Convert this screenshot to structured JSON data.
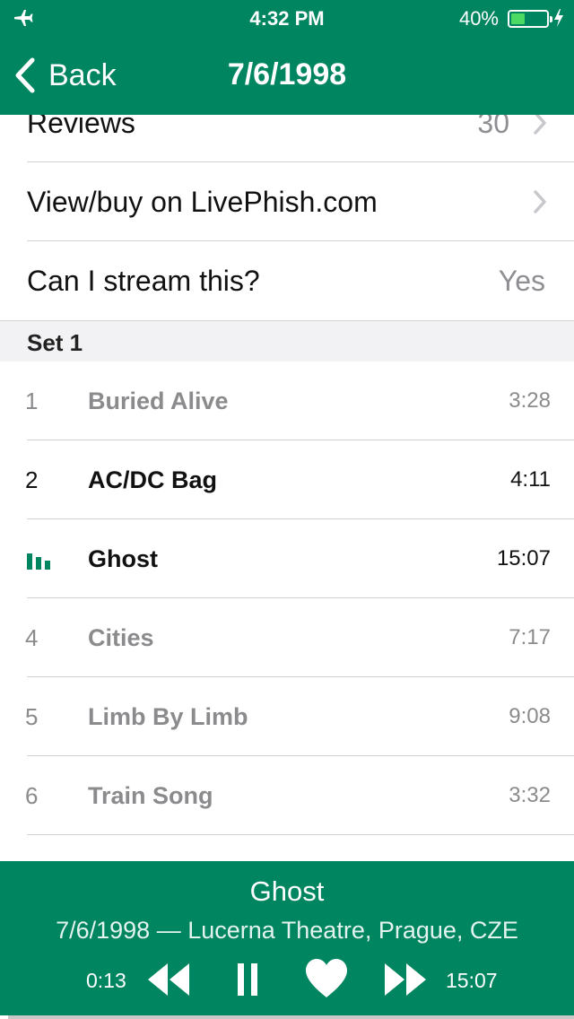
{
  "status_bar": {
    "time": "4:32 PM",
    "battery_percent": "40%",
    "battery_level": 0.4,
    "icons": [
      "airplane-icon",
      "battery-icon",
      "charging-bolt-icon"
    ]
  },
  "nav": {
    "back_label": "Back",
    "title": "7/6/1998"
  },
  "info_rows": {
    "reviews": {
      "label": "Reviews",
      "value": "30"
    },
    "livephish": {
      "label": "View/buy on LivePhish.com"
    },
    "stream": {
      "label": "Can I stream this?",
      "value": "Yes"
    }
  },
  "set": {
    "title": "Set 1",
    "tracks": [
      {
        "number": "1",
        "name": "Buried Alive",
        "duration": "3:28",
        "state": "dim"
      },
      {
        "number": "2",
        "name": "AC/DC Bag",
        "duration": "4:11",
        "state": "normal"
      },
      {
        "number": "3",
        "name": "Ghost",
        "duration": "15:07",
        "state": "playing"
      },
      {
        "number": "4",
        "name": "Cities",
        "duration": "7:17",
        "state": "dim"
      },
      {
        "number": "5",
        "name": "Limb By Limb",
        "duration": "9:08",
        "state": "dim"
      },
      {
        "number": "6",
        "name": "Train Song",
        "duration": "3:32",
        "state": "dim"
      }
    ]
  },
  "player": {
    "title": "Ghost",
    "subtitle": "7/6/1998 — Lucerna Theatre, Prague, CZE",
    "elapsed": "0:13",
    "total": "15:07",
    "progress": 0.0144
  },
  "colors": {
    "brand": "#008561",
    "dim_text": "#8b8b8e",
    "battery_fill": "#4cd964"
  }
}
